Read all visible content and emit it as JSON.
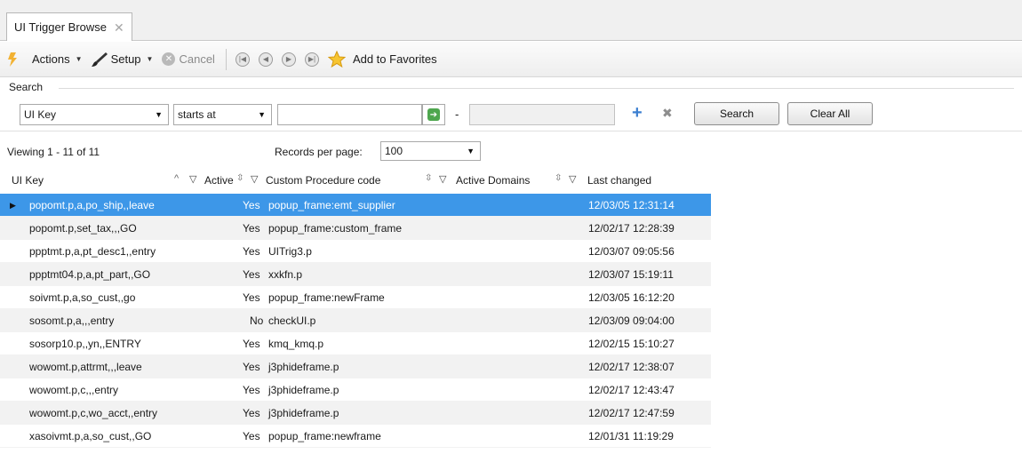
{
  "tab": {
    "title": "UI Trigger Browse",
    "close": "✕"
  },
  "toolbar": {
    "actions_label": "Actions",
    "setup_label": "Setup",
    "cancel_label": "Cancel",
    "favorites_label": "Add to Favorites"
  },
  "search": {
    "legend": "Search",
    "field_value": "UI Key",
    "operator_value": "starts at",
    "from_value": "",
    "range_dash": "-",
    "to_value": "",
    "search_button": "Search",
    "clear_button": "Clear All"
  },
  "paging": {
    "viewing": "Viewing 1 - 11 of 11",
    "records_label": "Records per page:",
    "records_value": "100"
  },
  "columns": {
    "ui_key": "UI Key",
    "active": "Active",
    "procedure": "Custom Procedure code",
    "domains": "Active Domains",
    "changed": "Last changed"
  },
  "rows": [
    {
      "ui_key": "popomt.p,a,po_ship,,leave",
      "active": "Yes",
      "procedure": "popup_frame:emt_supplier",
      "domains": "",
      "changed": "12/03/05 12:31:14"
    },
    {
      "ui_key": "popomt.p,set_tax,,,GO",
      "active": "Yes",
      "procedure": "popup_frame:custom_frame",
      "domains": "",
      "changed": "12/02/17 12:28:39"
    },
    {
      "ui_key": "ppptmt.p,a,pt_desc1,,entry",
      "active": "Yes",
      "procedure": "UITrig3.p",
      "domains": "",
      "changed": "12/03/07 09:05:56"
    },
    {
      "ui_key": "ppptmt04.p,a,pt_part,,GO",
      "active": "Yes",
      "procedure": "xxkfn.p",
      "domains": "",
      "changed": "12/03/07 15:19:11"
    },
    {
      "ui_key": "soivmt.p,a,so_cust,,go",
      "active": "Yes",
      "procedure": "popup_frame:newFrame",
      "domains": "",
      "changed": "12/03/05 16:12:20"
    },
    {
      "ui_key": "sosomt.p,a,,,entry",
      "active": "No",
      "procedure": "checkUI.p",
      "domains": "",
      "changed": "12/03/09 09:04:00"
    },
    {
      "ui_key": "sosorp10.p,,yn,,ENTRY",
      "active": "Yes",
      "procedure": "kmq_kmq.p",
      "domains": "",
      "changed": "12/02/15 15:10:27"
    },
    {
      "ui_key": "wowomt.p,attrmt,,,leave",
      "active": "Yes",
      "procedure": "j3phideframe.p",
      "domains": "",
      "changed": "12/02/17 12:38:07"
    },
    {
      "ui_key": "wowomt.p,c,,,entry",
      "active": "Yes",
      "procedure": "j3phideframe.p",
      "domains": "",
      "changed": "12/02/17 12:43:47"
    },
    {
      "ui_key": "wowomt.p,c,wo_acct,,entry",
      "active": "Yes",
      "procedure": "j3phideframe.p",
      "domains": "",
      "changed": "12/02/17 12:47:59"
    },
    {
      "ui_key": "xasoivmt.p,a,so_cust,,GO",
      "active": "Yes",
      "procedure": "popup_frame:newframe",
      "domains": "",
      "changed": "12/01/31 11:19:29"
    }
  ],
  "colors": {
    "selected": "#3d97e8",
    "alt_row": "#f2f2f2",
    "accent": "#3c7fd0"
  }
}
